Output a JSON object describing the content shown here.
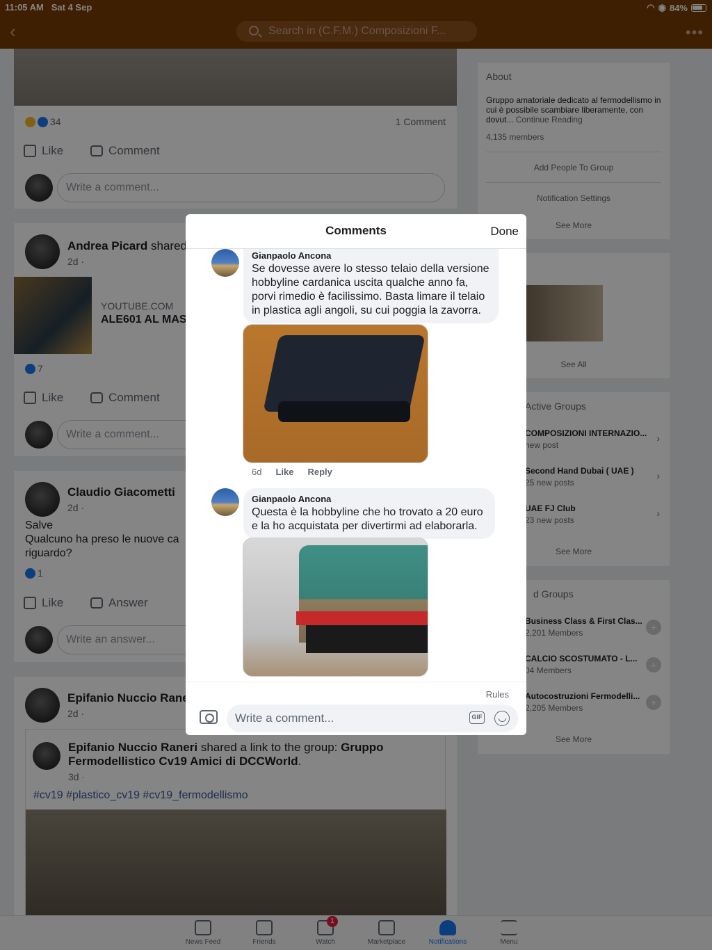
{
  "status_bar": {
    "time": "11:05 AM",
    "date": "Sat 4 Sep",
    "battery": "84%"
  },
  "nav": {
    "search_placeholder": "Search in (C.F.M.) Composizioni F..."
  },
  "feed": {
    "post1": {
      "reactions": "34",
      "comments": "1 Comment",
      "like": "Like",
      "comment": "Comment",
      "write": "Write a comment..."
    },
    "post2": {
      "name": "Andrea Picard",
      "action": "shared",
      "time": "2d ·",
      "link_site": "YOUTUBE.COM",
      "link_title": "ALE601 AL MAS",
      "reactions": "7",
      "like": "Like",
      "comment": "Comment",
      "write": "Write a comment..."
    },
    "post3": {
      "name": "Claudio Giacometti",
      "time": "2d ·",
      "text": "Salve\nQualcuno ha preso le nuove ca\nriguardo?",
      "reactions": "1",
      "like": "Like",
      "answer": "Answer",
      "write": "Write an answer..."
    },
    "post4": {
      "name": "Epifanio Nuccio Raner",
      "time": "2d ·",
      "shared_name": "Epifanio Nuccio Raneri",
      "shared_text": " shared a link to the group: ",
      "shared_group": "Gruppo Fermodellistico Cv19 Amici di DCCWorld",
      "shared_dot": ".",
      "shared_time": "3d ·",
      "hashtags": "#cv19 #plastico_cv19 #cv19_fermodellismo"
    }
  },
  "right": {
    "about": {
      "title": "About",
      "desc": "Gruppo amatoriale dedicato al fermodellismo in cui è possibile scambiare liberamente, con dovut...",
      "continue": " Continue Reading",
      "members": "4,135 members",
      "add_people": "Add People To Group",
      "notif": "Notification Settings",
      "see_more": "See More"
    },
    "photos": {
      "see_all": "See All"
    },
    "active": {
      "title": "Active Groups",
      "items": [
        {
          "name": "COMPOSIZIONI INTERNAZIO...",
          "sub": " new post"
        },
        {
          "name": "Second Hand Dubai ( UAE )",
          "sub": "25 new posts"
        },
        {
          "name": "UAE FJ Club",
          "sub": "23 new posts"
        }
      ],
      "see_more": "See More"
    },
    "suggested": {
      "title": "d Groups",
      "items": [
        {
          "name": "Business Class & First Clas...",
          "sub": "2,201 Members"
        },
        {
          "name": "CALCIO SCOSTUMATO - L...",
          "sub": "04 Members"
        },
        {
          "name": "Autocostruzioni Fermodelli...",
          "sub": "2,205 Members"
        }
      ],
      "see_more": "See More"
    }
  },
  "tabs": [
    {
      "label": "News Feed"
    },
    {
      "label": "Friends"
    },
    {
      "label": "Watch",
      "badge": "1"
    },
    {
      "label": "Marketplace"
    },
    {
      "label": "Notifications"
    },
    {
      "label": "Menu"
    }
  ],
  "modal": {
    "title": "Comments",
    "done": "Done",
    "comments": [
      {
        "author": "Gianpaolo Ancona",
        "text": "Se dovesse avere lo stesso telaio della versione\nhobbyline cardanica uscita qualche anno fa,\nporvi rimedio è facilissimo. Basta limare il telaio\nin plastica agli angoli, su cui poggia la zavorra.",
        "time": "6d",
        "like": "Like",
        "reply": "Reply"
      },
      {
        "author": "Gianpaolo Ancona",
        "text": "Questa è la hobbyline che ho trovato a 20 euro\ne la ho acquistata per divertirmi ad elaborarla."
      }
    ],
    "rules": "Rules",
    "input_placeholder": "Write a comment...",
    "gif": "GIF"
  }
}
